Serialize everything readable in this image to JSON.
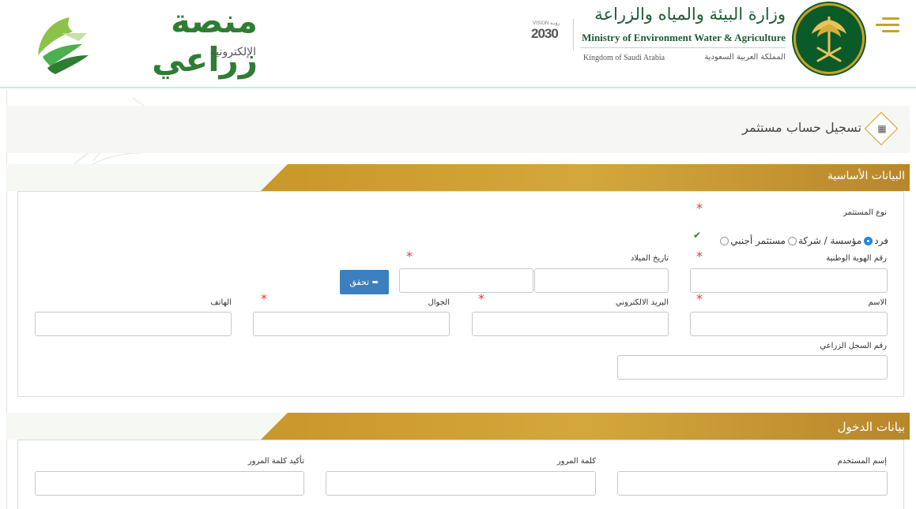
{
  "header": {
    "ministry_ar": "وزارة البيئة والمياه والزراعة",
    "ministry_en": "Ministry of Environment Water & Agriculture",
    "kingdom_en": "Kingdom of Saudi Arabia",
    "kingdom_ar": "المملكة العربية السعودية",
    "vision_top": "VISION رؤيـة",
    "vision_year": "2030",
    "brand_title": "منصة زراعي",
    "brand_subtitle": "الإلكترونية",
    "menu_icon": "hamburger-icon",
    "accent_color": "#c9a227",
    "brand_color": "#2e7d32"
  },
  "page": {
    "title": "تسجيل حساب مستثمر",
    "title_icon": "document-icon"
  },
  "basic_section": {
    "title": "البيانات الأساسية",
    "investor_type_label": "نوع المستثمر",
    "options": [
      "فرد",
      "مؤسسة / شركة",
      "مستثمر أجنبي"
    ],
    "selected_option": "فرد",
    "national_id_label": "رقم الهوية الوطنية",
    "birth_date_label": "تاريخ الميلاد",
    "verify_button": "تحقق",
    "name_label": "الاسم",
    "email_label": "البريد الالكتروني",
    "mobile_label": "الجوال",
    "phone_label": "الهاتف",
    "agri_reg_label": "رقم السجل الزراعي",
    "required_mark": "*",
    "check_mark": "✔"
  },
  "login_section": {
    "title": "بيانات الدخول",
    "username_label": "إسم المستخدم",
    "password_label": "كلمة المرور",
    "confirm_password_label": "تأكيد كلمة المرور"
  }
}
